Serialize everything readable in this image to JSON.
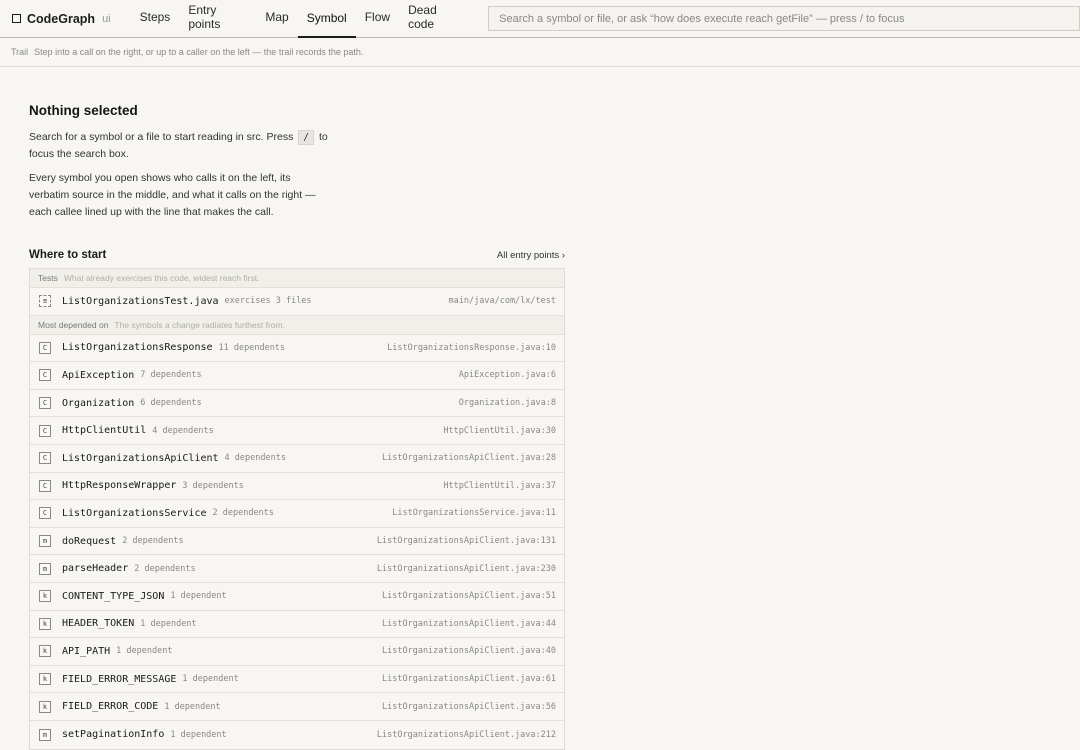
{
  "app": {
    "brand": "CodeGraph",
    "brand_sub": "ui",
    "tabs": [
      {
        "label": "Steps"
      },
      {
        "label": "Entry points"
      },
      {
        "label": "Map"
      },
      {
        "label": "Symbol",
        "active": true
      },
      {
        "label": "Flow"
      },
      {
        "label": "Dead code"
      }
    ],
    "search_placeholder": "Search a symbol or file, or ask “how does execute reach getFile” — press / to focus"
  },
  "trail": {
    "label": "Trail",
    "text": "Step into a call on the right, or up to a caller on the left — the trail records the path."
  },
  "empty": {
    "title": "Nothing selected",
    "para1_before": "Search for a symbol or a file to start reading in src. Press",
    "para1_key": "/",
    "para1_after": "to focus the search box.",
    "para2": "Every symbol you open shows who calls it on the left, its verbatim source in the middle, and what it calls on the right — each callee lined up with the line that makes the call."
  },
  "where": {
    "title": "Where to start",
    "all_entry_link": "All entry points ›",
    "tests_section": {
      "name": "Tests",
      "desc": "What already exercises this code, widest reach first."
    },
    "tests": [
      {
        "kind": "≡",
        "name": "ListOrganizationsTest.java",
        "meta": "exercises 3 files",
        "loc": "main/java/com/lx/test"
      }
    ],
    "depended_section": {
      "name": "Most depended on",
      "desc": "The symbols a change radiates furthest from."
    },
    "depended": [
      {
        "kind": "C",
        "name": "ListOrganizationsResponse",
        "meta": "11 dependents",
        "loc": "ListOrganizationsResponse.java:10"
      },
      {
        "kind": "C",
        "name": "ApiException",
        "meta": "7 dependents",
        "loc": "ApiException.java:6"
      },
      {
        "kind": "C",
        "name": "Organization",
        "meta": "6 dependents",
        "loc": "Organization.java:8"
      },
      {
        "kind": "C",
        "name": "HttpClientUtil",
        "meta": "4 dependents",
        "loc": "HttpClientUtil.java:30"
      },
      {
        "kind": "C",
        "name": "ListOrganizationsApiClient",
        "meta": "4 dependents",
        "loc": "ListOrganizationsApiClient.java:28"
      },
      {
        "kind": "C",
        "name": "HttpResponseWrapper",
        "meta": "3 dependents",
        "loc": "HttpClientUtil.java:37"
      },
      {
        "kind": "C",
        "name": "ListOrganizationsService",
        "meta": "2 dependents",
        "loc": "ListOrganizationsService.java:11"
      },
      {
        "kind": "m",
        "name": "doRequest",
        "meta": "2 dependents",
        "loc": "ListOrganizationsApiClient.java:131"
      },
      {
        "kind": "m",
        "name": "parseHeader",
        "meta": "2 dependents",
        "loc": "ListOrganizationsApiClient.java:230"
      },
      {
        "kind": "k",
        "name": "CONTENT_TYPE_JSON",
        "meta": "1 dependent",
        "loc": "ListOrganizationsApiClient.java:51"
      },
      {
        "kind": "k",
        "name": "HEADER_TOKEN",
        "meta": "1 dependent",
        "loc": "ListOrganizationsApiClient.java:44"
      },
      {
        "kind": "k",
        "name": "API_PATH",
        "meta": "1 dependent",
        "loc": "ListOrganizationsApiClient.java:40"
      },
      {
        "kind": "k",
        "name": "FIELD_ERROR_MESSAGE",
        "meta": "1 dependent",
        "loc": "ListOrganizationsApiClient.java:61"
      },
      {
        "kind": "k",
        "name": "FIELD_ERROR_CODE",
        "meta": "1 dependent",
        "loc": "ListOrganizationsApiClient.java:56"
      },
      {
        "kind": "m",
        "name": "setPaginationInfo",
        "meta": "1 dependent",
        "loc": "ListOrganizationsApiClient.java:212"
      }
    ]
  }
}
